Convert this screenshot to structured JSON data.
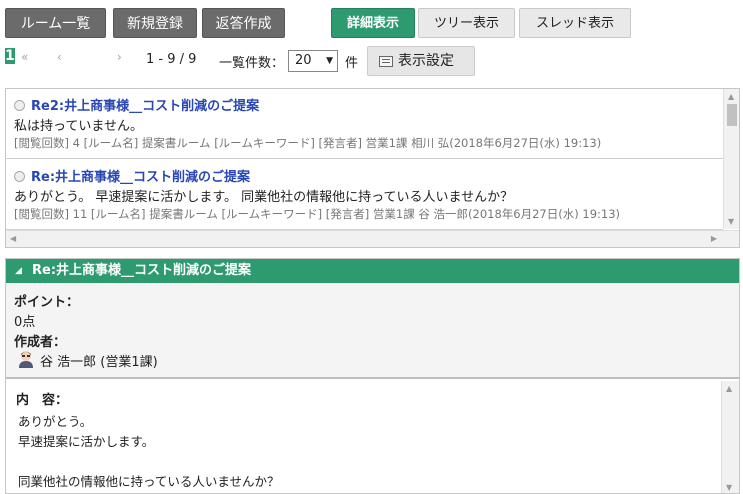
{
  "toolbar": {
    "room_list": "ルーム一覧",
    "new_post": "新規登録",
    "reply": "返答作成",
    "detail_view": "詳細表示",
    "tree_view": "ツリー表示",
    "thread_view": "スレッド表示"
  },
  "pager": {
    "first": "«",
    "prev": "‹",
    "current": "1",
    "next": "›",
    "count": "1 - 9 / 9",
    "per_page_label": "一覧件数：",
    "per_page_value": "20",
    "per_page_unit": "件",
    "display_settings": "表示設定"
  },
  "messages": [
    {
      "title": "Re2:井上商事様__コスト削減のご提案",
      "body": "私は持っていません。",
      "meta": "[閲覧回数] 4 [ルーム名] 提案書ルーム [ルームキーワード] [発言者] 営業1課 相川 弘(2018年6月27日(水) 19:13)"
    },
    {
      "title": "Re:井上商事様__コスト削減のご提案",
      "body": "ありがとう。 早速提案に活かします。 同業他社の情報他に持っている人いませんか？",
      "meta": "[閲覧回数] 11 [ルーム名] 提案書ルーム [ルームキーワード] [発言者] 営業1課 谷 浩一郎(2018年6月27日(水) 19:13)"
    }
  ],
  "detail": {
    "title": "Re:井上商事様__コスト削減のご提案",
    "point_label": "ポイント：",
    "point_value": "0点",
    "author_label": "作成者：",
    "author_name": "谷 浩一郎 (営業1課)",
    "content_label": "内　容：",
    "content_lines": [
      "ありがとう。",
      "早速提案に活かします。",
      "",
      "同業他社の情報他に持っている人いませんか？"
    ]
  },
  "colors": {
    "accent_green": "#2d9a70",
    "link_blue": "#2846b5",
    "dark_button": "#6b6b6b"
  }
}
